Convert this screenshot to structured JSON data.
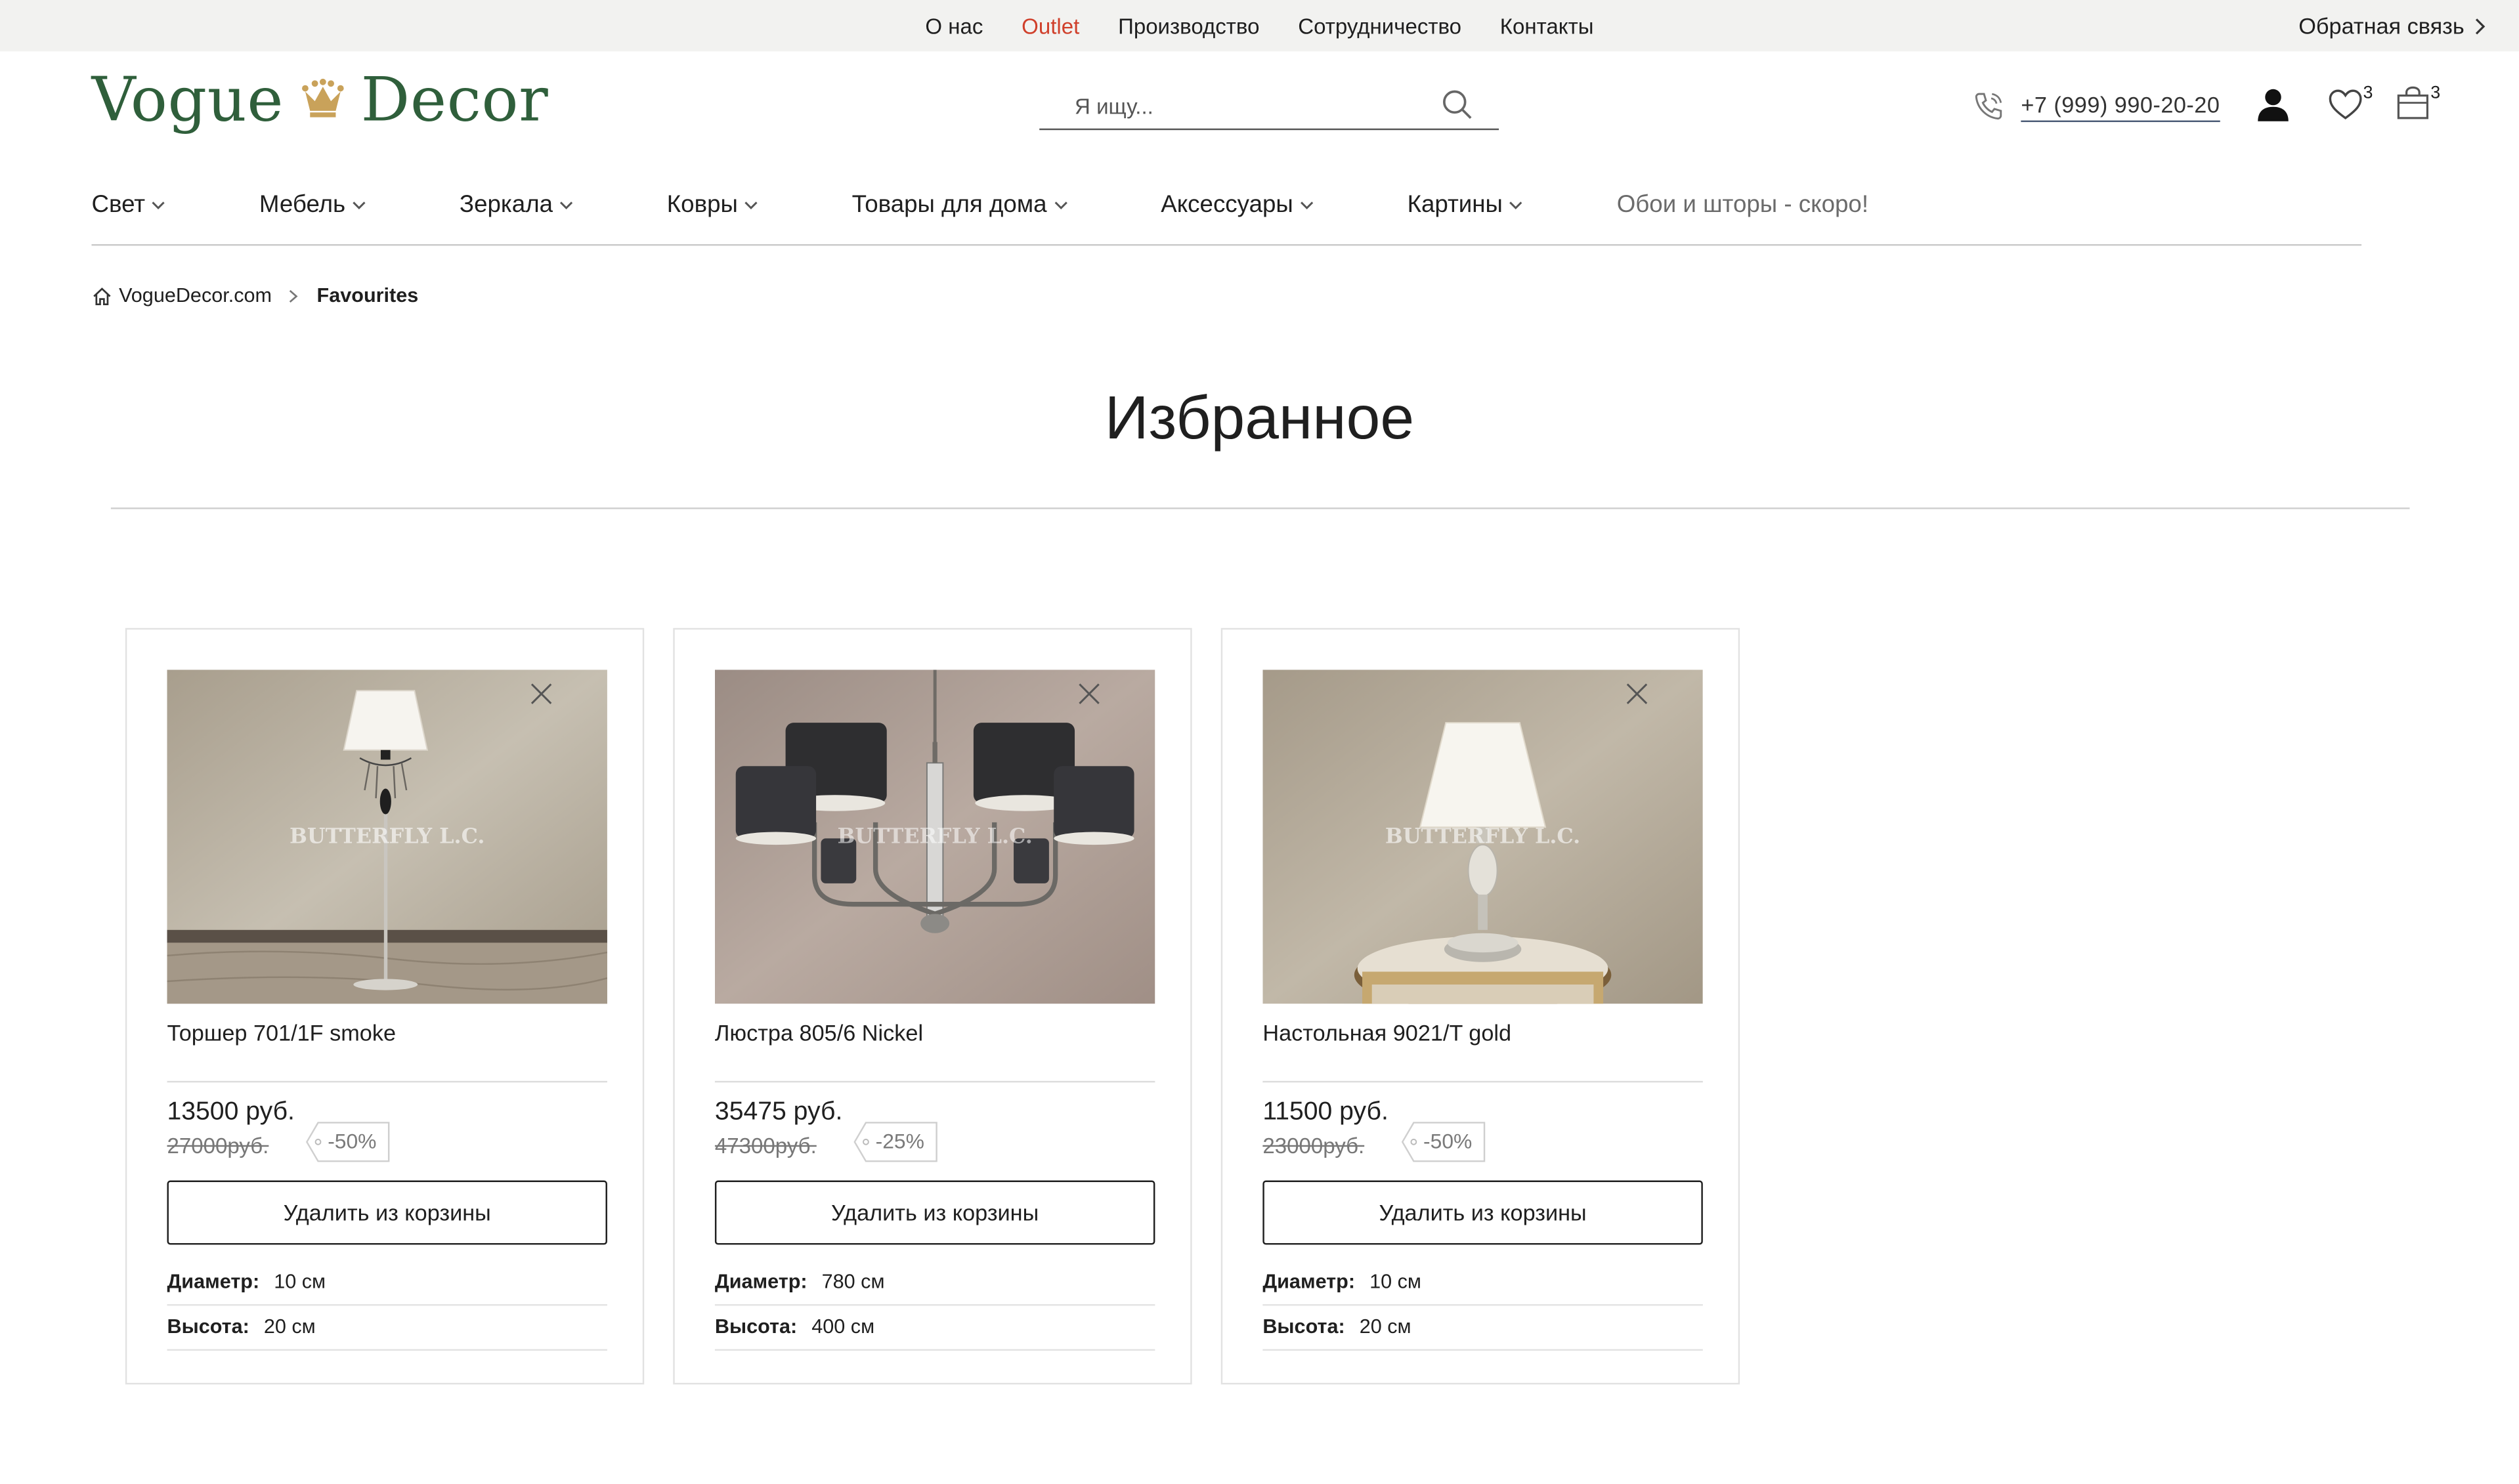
{
  "top_nav": {
    "links": [
      "О нас",
      "Outlet",
      "Производство",
      "Сотрудничество",
      "Контакты"
    ],
    "feedback": "Обратная связь"
  },
  "header": {
    "logo_left": "Vogue",
    "logo_right": "Decor",
    "search_placeholder": "Я ищу...",
    "phone": "+7 (999) 990-20-20",
    "favourites_count": "3",
    "cart_count": "3"
  },
  "categories": [
    "Свет",
    "Мебель",
    "Зеркала",
    "Ковры",
    "Товары для дома",
    "Аксессуары",
    "Картины"
  ],
  "categories_soon": "Обои и шторы - скоро!",
  "breadcrumb": {
    "home": "VogueDecor.com",
    "current": "Favourites"
  },
  "page_title": "Избранное",
  "products": [
    {
      "name": "Торшер 701/1F smoke",
      "price": "13500 руб.",
      "old_price": "27000руб.",
      "discount": "-50%",
      "button": "Удалить из корзины",
      "specs": [
        {
          "label": "Диаметр:",
          "value": "10 см"
        },
        {
          "label": "Высота:",
          "value": "20 см"
        }
      ],
      "watermark": "BUTTERFLY L.C."
    },
    {
      "name": "Люстра 805/6 Nickel",
      "price": "35475 руб.",
      "old_price": "47300руб.",
      "discount": "-25%",
      "button": "Удалить из корзины",
      "specs": [
        {
          "label": "Диаметр:",
          "value": "780 см"
        },
        {
          "label": "Высота:",
          "value": "400 см"
        }
      ],
      "watermark": "BUTTERFLY L.C."
    },
    {
      "name": "Настольная 9021/T gold",
      "price": "11500 руб.",
      "old_price": "23000руб.",
      "discount": "-50%",
      "button": "Удалить из корзины",
      "specs": [
        {
          "label": "Диаметр:",
          "value": "10 см"
        },
        {
          "label": "Высота:",
          "value": "20 см"
        }
      ],
      "watermark": "BUTTERFLY L.C."
    }
  ],
  "colors": {
    "brand_green": "#2f5f3b",
    "outlet_red": "#d0402b",
    "crown_gold": "#c9a25a",
    "topbar_bg": "#f2f2f0"
  },
  "icons": [
    "chevron-right-icon",
    "crown-icon",
    "search-icon",
    "phone-icon",
    "user-icon",
    "heart-icon",
    "bag-icon",
    "chevron-down-icon",
    "home-icon",
    "close-icon"
  ]
}
